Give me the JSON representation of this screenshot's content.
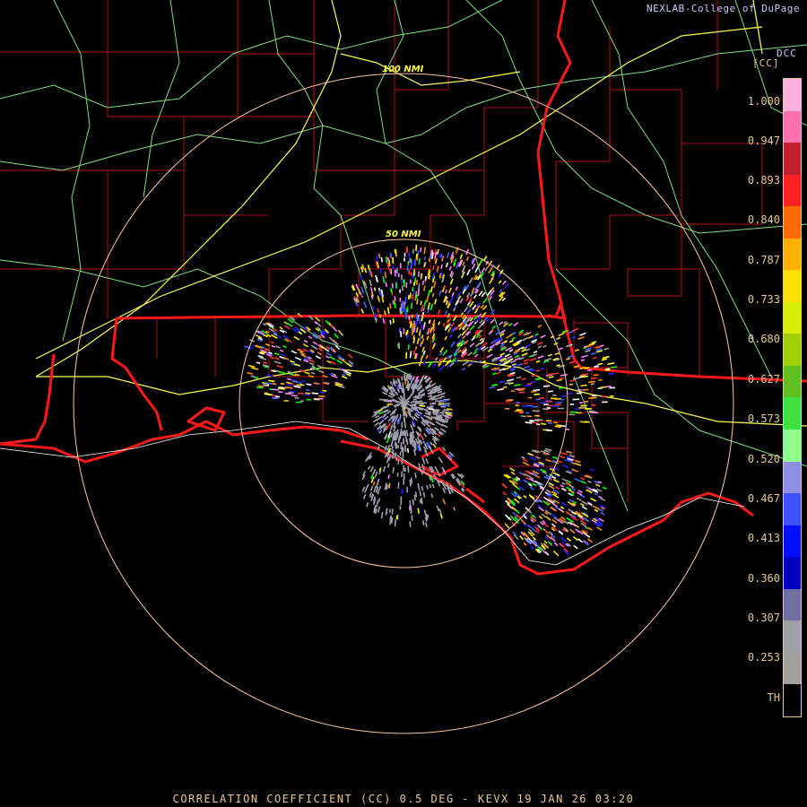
{
  "header": {
    "credit": "NEXLAB-College of DuPage",
    "station_code": "DCC"
  },
  "footer": {
    "title": "CORRELATION COEFFICIENT (CC) 0.5 DEG - KEVX 19 JAN 26 03:20"
  },
  "colorbar": {
    "unit": "[CC]",
    "labels": [
      "1.000",
      "0.947",
      "0.893",
      "0.840",
      "0.787",
      "0.733",
      "0.680",
      "0.627",
      "0.573",
      "0.520",
      "0.467",
      "0.413",
      "0.360",
      "0.307",
      "0.253",
      "TH"
    ],
    "colors": [
      "#ffb0e0",
      "#ff70b0",
      "#c02030",
      "#ff2020",
      "#ff6a00",
      "#ffb000",
      "#ffe000",
      "#d8f000",
      "#a0d000",
      "#60c020",
      "#40e040",
      "#90ff90",
      "#9090e0",
      "#4050ff",
      "#0010ff",
      "#0000c0",
      "#7070a0",
      "#a0a0a8",
      "#a0a0a0",
      "#000000"
    ]
  },
  "range_rings": [
    {
      "label": "50 NMI"
    },
    {
      "label": "100 NMI"
    }
  ],
  "map_colors": {
    "state_border": "#ff2020",
    "county_border": "#c01010",
    "highway_interstate": "#ffff60",
    "highway_other": "#80e080",
    "range_ring": "#ffc8a0"
  }
}
